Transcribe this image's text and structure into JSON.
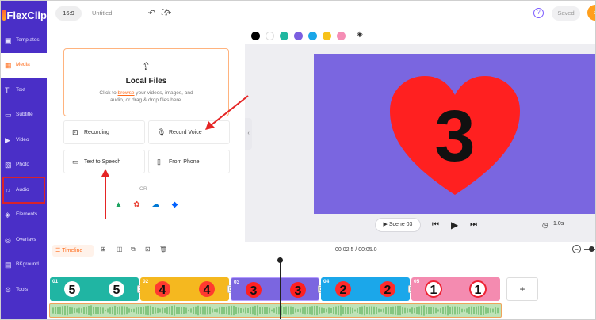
{
  "app": {
    "logo": "FlexClip",
    "title": "Untitled",
    "ratio": "16:9",
    "saved": "Saved",
    "avatar": "E"
  },
  "sidebar": {
    "items": [
      {
        "label": "Templates",
        "icon": "templates-icon",
        "glyph": "▣"
      },
      {
        "label": "Media",
        "icon": "media-icon",
        "glyph": "▦"
      },
      {
        "label": "Text",
        "icon": "text-icon",
        "glyph": "T"
      },
      {
        "label": "Subtitle",
        "icon": "subtitle-icon",
        "glyph": "▭"
      },
      {
        "label": "Video",
        "icon": "video-icon",
        "glyph": "▶"
      },
      {
        "label": "Photo",
        "icon": "photo-icon",
        "glyph": "▨"
      },
      {
        "label": "Audio",
        "icon": "audio-icon",
        "glyph": "♫"
      },
      {
        "label": "Elements",
        "icon": "elements-icon",
        "glyph": "◈"
      },
      {
        "label": "Overlays",
        "icon": "overlays-icon",
        "glyph": "◎"
      },
      {
        "label": "BKground",
        "icon": "background-icon",
        "glyph": "▤"
      },
      {
        "label": "Tools",
        "icon": "tools-icon",
        "glyph": "⚙"
      }
    ],
    "active": "Media"
  },
  "panel": {
    "local_files": {
      "title": "Local Files",
      "desc_pre": "Click to ",
      "browse": "browse",
      "desc_post": " your videos, images, and audio, or drag & drop files here."
    },
    "options": {
      "recording": "Recording",
      "record_voice": "Record Voice",
      "text_to_speech": "Text to Speech",
      "from_phone": "From Phone"
    },
    "or": "OR"
  },
  "colors": [
    "#000000",
    "#ffffff",
    "#1fb7a0",
    "#7b5fe0",
    "#1aa6e8",
    "#f7c21a",
    "#f58db5"
  ],
  "preview": {
    "scene": "Scene 03",
    "duration": "1.0s",
    "number": "3",
    "bg": "#7a66e0",
    "heart": "#ff2020"
  },
  "timeline": {
    "label": "Timeline",
    "time": "00:02.5 / 00:05.0",
    "clips": [
      {
        "num": "01",
        "digit": "5",
        "bg": "#20b5a3"
      },
      {
        "num": "02",
        "digit": "4",
        "bg": "#f5b81f"
      },
      {
        "num": "03",
        "digit": "3",
        "bg": "#7b66e0"
      },
      {
        "num": "04",
        "digit": "2",
        "bg": "#1ba7ea"
      },
      {
        "num": "05",
        "digit": "1",
        "bg": "#f48bb0"
      }
    ],
    "add": "+"
  }
}
